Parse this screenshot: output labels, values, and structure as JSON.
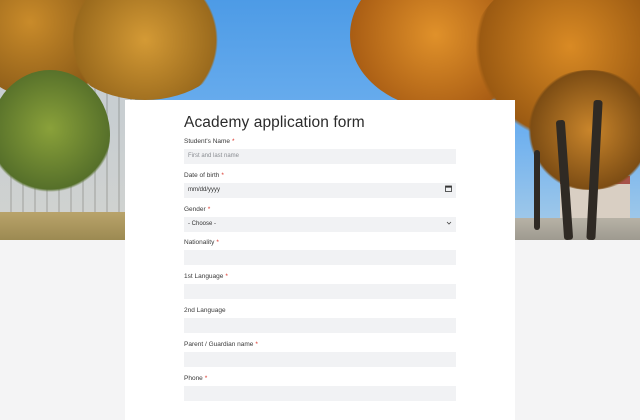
{
  "form": {
    "title": "Academy application form",
    "fields": [
      {
        "label": "Student's Name",
        "required": "*",
        "placeholder": "First and last name",
        "type": "text"
      },
      {
        "label": "Date of birth",
        "required": "*",
        "value": "mm/dd/yyyy",
        "type": "date",
        "icon": "calendar-icon"
      },
      {
        "label": "Gender",
        "required": "*",
        "value": "- Choose -",
        "type": "select",
        "icon": "chevron-down-icon"
      },
      {
        "label": "Nationality",
        "required": "*",
        "placeholder": "",
        "type": "text"
      },
      {
        "label": "1st Language",
        "required": "*",
        "placeholder": "",
        "type": "text"
      },
      {
        "label": "2nd Language",
        "required": "",
        "placeholder": "",
        "type": "text"
      },
      {
        "label": "Parent / Guardian name",
        "required": "*",
        "placeholder": "",
        "type": "text"
      },
      {
        "label": "Phone",
        "required": "*",
        "placeholder": "",
        "type": "text"
      }
    ]
  },
  "colors": {
    "required_marker": "#d93025",
    "input_background": "#f1f2f4",
    "page_background": "#f4f4f5"
  }
}
